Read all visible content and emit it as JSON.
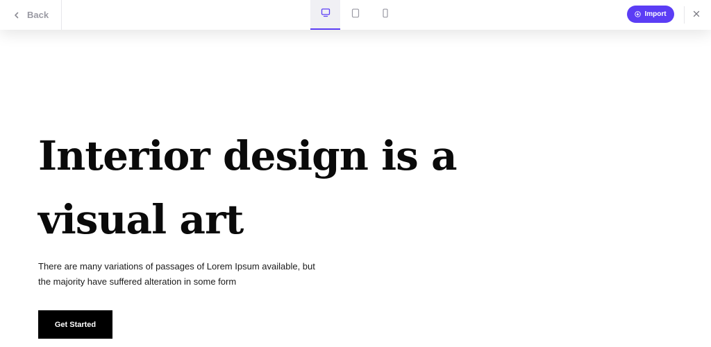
{
  "toolbar": {
    "back_label": "Back",
    "back_icon": "chevron-left-icon",
    "devices": [
      {
        "name": "desktop",
        "icon": "desktop-monitor-icon",
        "active": true
      },
      {
        "name": "tablet",
        "icon": "tablet-icon",
        "active": false
      },
      {
        "name": "mobile",
        "icon": "mobile-phone-icon",
        "active": false
      }
    ],
    "import_label": "Import",
    "import_icon": "download-circle-icon",
    "close_icon": "close-icon"
  },
  "hero": {
    "headline": "Interior design is a visual art",
    "subtext": "There are many variations of passages of Lorem Ipsum available, but the majority have suffered alteration in some form",
    "cta_label": "Get Started"
  },
  "colors": {
    "accent": "#5b3df5",
    "text": "#0a0a0a",
    "muted": "#9a9aa3",
    "cta_bg": "#000000"
  }
}
